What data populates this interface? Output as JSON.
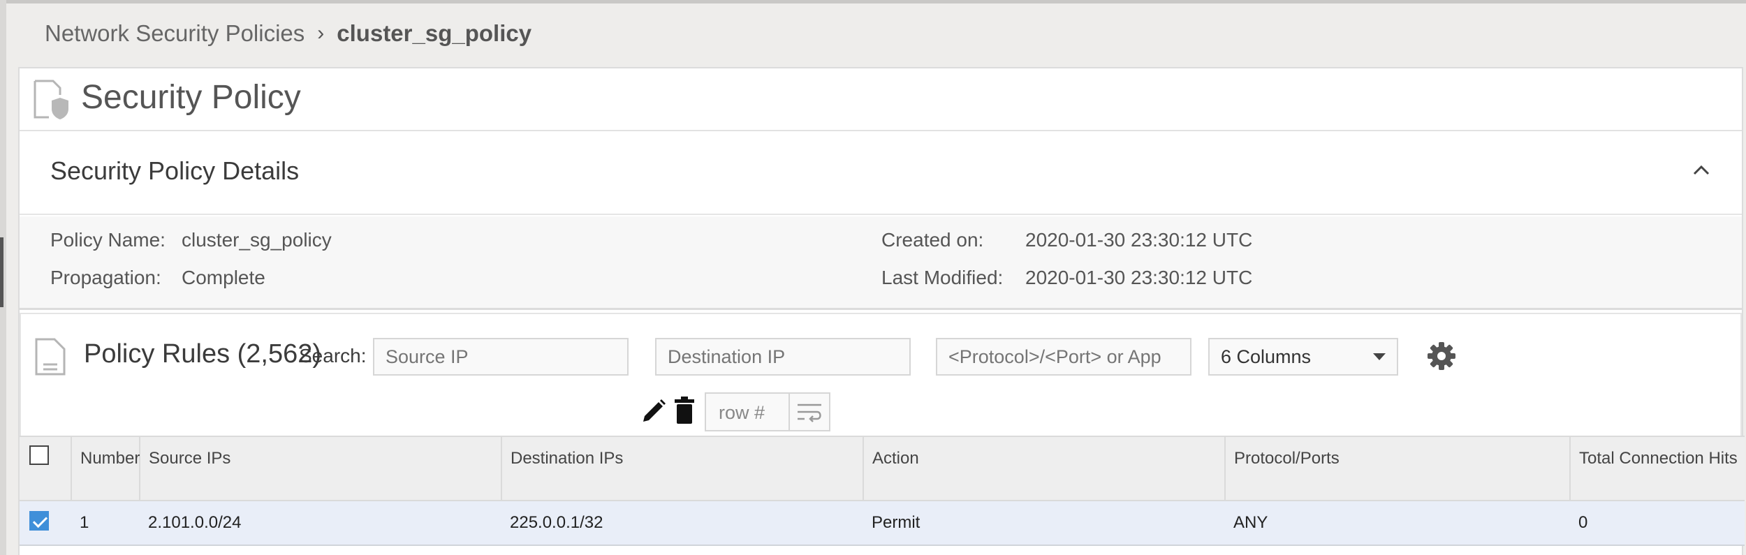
{
  "breadcrumb": {
    "parent": "Network Security Policies",
    "separator": "›",
    "current": "cluster_sg_policy"
  },
  "page": {
    "title": "Security Policy"
  },
  "details": {
    "section_title": "Security Policy Details",
    "policy_name_label": "Policy Name:",
    "policy_name": "cluster_sg_policy",
    "propagation_label": "Propagation:",
    "propagation": "Complete",
    "created_label": "Created on:",
    "created": "2020-01-30 23:30:12 UTC",
    "modified_label": "Last Modified:",
    "modified": "2020-01-30 23:30:12 UTC"
  },
  "rules": {
    "title": "Policy Rules (2,562)",
    "search_label": "Search:",
    "source_placeholder": "Source IP",
    "destination_placeholder": "Destination IP",
    "protocol_placeholder": "<Protocol>/<Port> or App",
    "columns_select": "6 Columns",
    "row_placeholder": "row #",
    "columns": [
      "Number",
      "Source IPs",
      "Destination IPs",
      "Action",
      "Protocol/Ports",
      "Total Connection Hits"
    ],
    "rows": [
      {
        "selected": true,
        "number": "1",
        "source": "2.101.0.0/24",
        "destination": "225.0.0.1/32",
        "action": "Permit",
        "protocol": "ANY",
        "hits": "0"
      }
    ]
  },
  "colors": {
    "accent": "#3f8fd9",
    "selected_row": "#e9eef8",
    "header_bg": "#eeeeee"
  }
}
